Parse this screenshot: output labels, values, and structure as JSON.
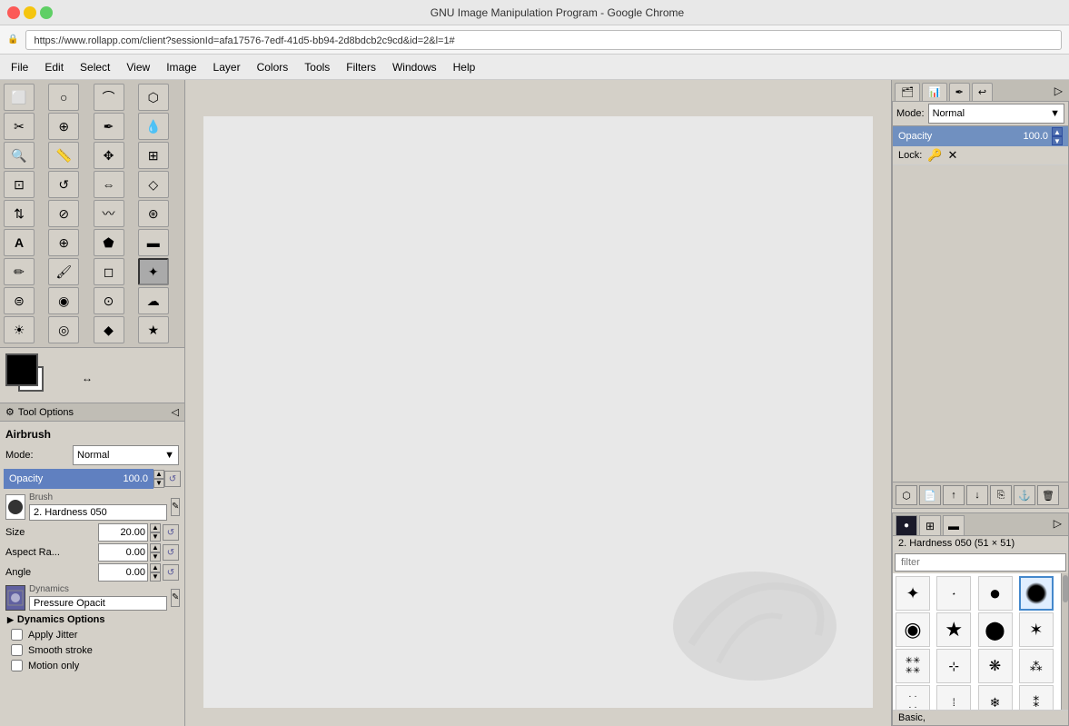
{
  "browser": {
    "title": "GNU Image Manipulation Program - Google Chrome",
    "url": "https://www.rollapp.com/client?sessionId=afa17576-7edf-41d5-bb94-2d8bdcb2c9cd&id=2&l=1#"
  },
  "menubar": {
    "items": [
      "File",
      "Edit",
      "Select",
      "View",
      "Image",
      "Layer",
      "Colors",
      "Tools",
      "Filters",
      "Windows",
      "Help"
    ]
  },
  "toolbar": {
    "title": "Tool Options",
    "tool_name": "Airbrush",
    "mode_label": "Mode:",
    "mode_value": "Normal",
    "opacity_label": "Opacity",
    "opacity_value": "100.0",
    "brush_label": "Brush",
    "brush_name": "2. Hardness 050",
    "size_label": "Size",
    "size_value": "20.00",
    "aspect_label": "Aspect Ra...",
    "aspect_value": "0.00",
    "angle_label": "Angle",
    "angle_value": "0.00",
    "dynamics_label": "Dynamics",
    "dynamics_value": "Pressure Opacit",
    "dynamics_options": "Dynamics Options",
    "apply_jitter": "Apply Jitter",
    "smooth_stroke": "Smooth stroke",
    "motion_only": "Motion only"
  },
  "layers_panel": {
    "mode_label": "Mode:",
    "mode_value": "Normal",
    "opacity_label": "Opacity",
    "opacity_value": "100.0",
    "lock_label": "Lock:"
  },
  "brushes_panel": {
    "brush_info": "2. Hardness 050 (51 × 51)",
    "filter_placeholder": "filter",
    "footer_label": "Basic,"
  },
  "icons": {
    "rect_select": "⬜",
    "ellipse_select": "⬤",
    "free_select": "✂",
    "fuzzy_select": "🔮",
    "scissors": "✂",
    "paths": "✒",
    "color_picker": "💉",
    "zoom": "🔍",
    "measure": "📏",
    "move": "✥",
    "align": "⊞",
    "crop": "⊡",
    "rotate": "↺",
    "scale": "⇔",
    "shear": "⊘",
    "perspective": "◇",
    "flip": "⇅",
    "text": "A",
    "heal": "⊕",
    "bucket": "🪣",
    "gradient": "▬",
    "pencil": "✏",
    "brush_paint": "🖌",
    "eraser": "◻",
    "airbrush": "✦",
    "clone": "⊜",
    "smudge": "◉",
    "dodge": "☀",
    "burn": "☁",
    "blur": "◎",
    "sharpen": "◆",
    "chevron_down": "▼",
    "chevron_right": "▶"
  }
}
